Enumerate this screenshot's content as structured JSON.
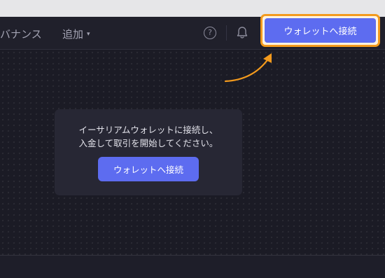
{
  "header": {
    "nav_governance": "バナンス",
    "nav_add": "追加",
    "help_label": "?",
    "connect_label": "ウォレットへ接続"
  },
  "card": {
    "message_line1": "イーサリアムウォレットに接続し、",
    "message_line2": "入金して取引を開始してください。",
    "button_label": "ウォレットへ接続"
  },
  "icons": {
    "caret": "chevron-down-icon",
    "help": "help-icon",
    "bell": "bell-icon",
    "arrow": "annotation-arrow-icon"
  },
  "colors": {
    "accent": "#5d6cf0",
    "highlight": "#f39a1d",
    "background": "#1b1b25"
  }
}
